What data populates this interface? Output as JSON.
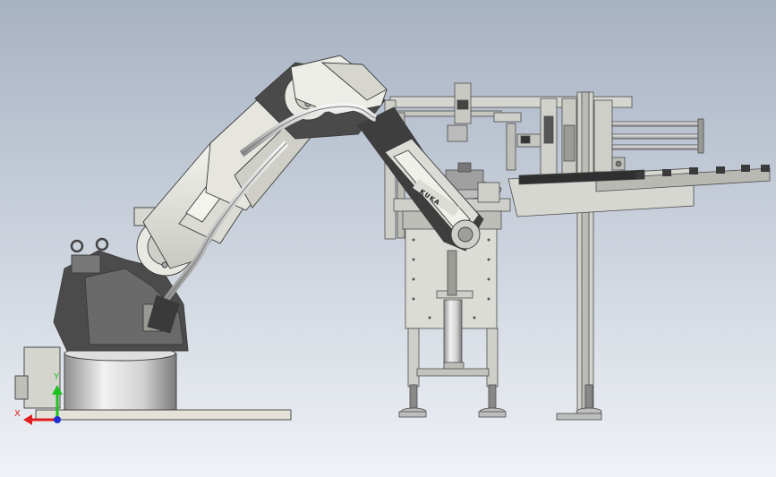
{
  "viewport": {
    "background_top": "#a7b2c3",
    "background_bottom": "#eff2f6"
  },
  "axis_triad": {
    "x_label": "X",
    "y_label": "Y",
    "x_color": "#e01c1c",
    "y_color": "#1ec21e",
    "z_color": "#1f2fd6"
  },
  "robot": {
    "body_color": "#e6e6df",
    "dark_color": "#3c3c3c",
    "base_color": "#cfcfcf",
    "brand_text": "KUKA"
  },
  "machine": {
    "frame_color": "#c8c8c4",
    "panel_color": "#dcdcd6"
  }
}
